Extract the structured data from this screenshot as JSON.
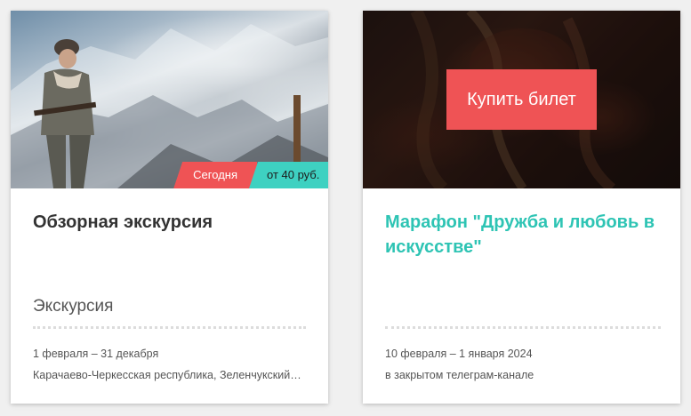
{
  "cards": [
    {
      "badge_today": "Сегодня",
      "badge_price": "от 40 руб.",
      "title": "Обзорная экскурсия",
      "category": "Экскурсия",
      "dates": "1 февраля – 31 декабря",
      "location": "Карачаево-Черкесская республика, Зеленчукский район"
    },
    {
      "buy_label": "Купить билет",
      "title": "Марафон \"Дружба и любовь в искусстве\"",
      "dates": "10 февраля – 1 января 2024",
      "location": "в закрытом телеграм-канале"
    }
  ],
  "colors": {
    "accent_red": "#ef5355",
    "accent_teal": "#3ed1c1",
    "link_teal": "#2ec4b4"
  }
}
